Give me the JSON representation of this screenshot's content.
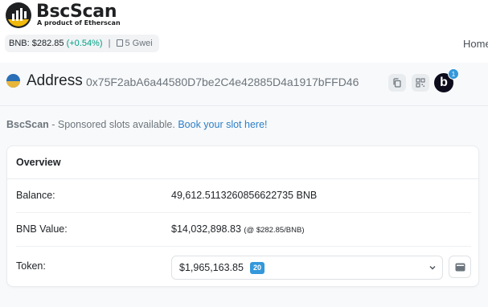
{
  "header": {
    "brand": "BscScan",
    "brand_sub": "A product of Etherscan",
    "bnb_price_label": "BNB: $282.85",
    "bnb_change": "(+0.54%)",
    "separator": "|",
    "gas": "5 Gwei",
    "nav_home": "Home"
  },
  "address": {
    "label": "Address",
    "hash": "0x75F2abA6a44580D7be2C4e42885D4a1917bFFD46",
    "notification_letter": "b",
    "notification_count": "1"
  },
  "sponsor": {
    "brand": "BscScan",
    "text": " - Sponsored slots available. ",
    "link": "Book your slot here!"
  },
  "overview": {
    "title": "Overview",
    "balance_label": "Balance:",
    "balance_value": "49,612.5113260856622735 BNB",
    "value_label": "BNB Value:",
    "value_amount": "$14,032,898.83",
    "value_rate": "(@ $282.85/BNB)",
    "token_label": "Token:",
    "token_value": "$1,965,163.85",
    "token_count": "20"
  },
  "icons": [
    "bscscan-logo-icon",
    "gas-pump-icon",
    "address-avatar-icon",
    "copy-icon",
    "qr-code-icon",
    "chevron-down-icon",
    "wallet-icon"
  ],
  "colors": {
    "accent": "#3498db",
    "positive": "#00a186",
    "link": "#2d7fc7",
    "brand_yellow": "#f0b90b"
  }
}
